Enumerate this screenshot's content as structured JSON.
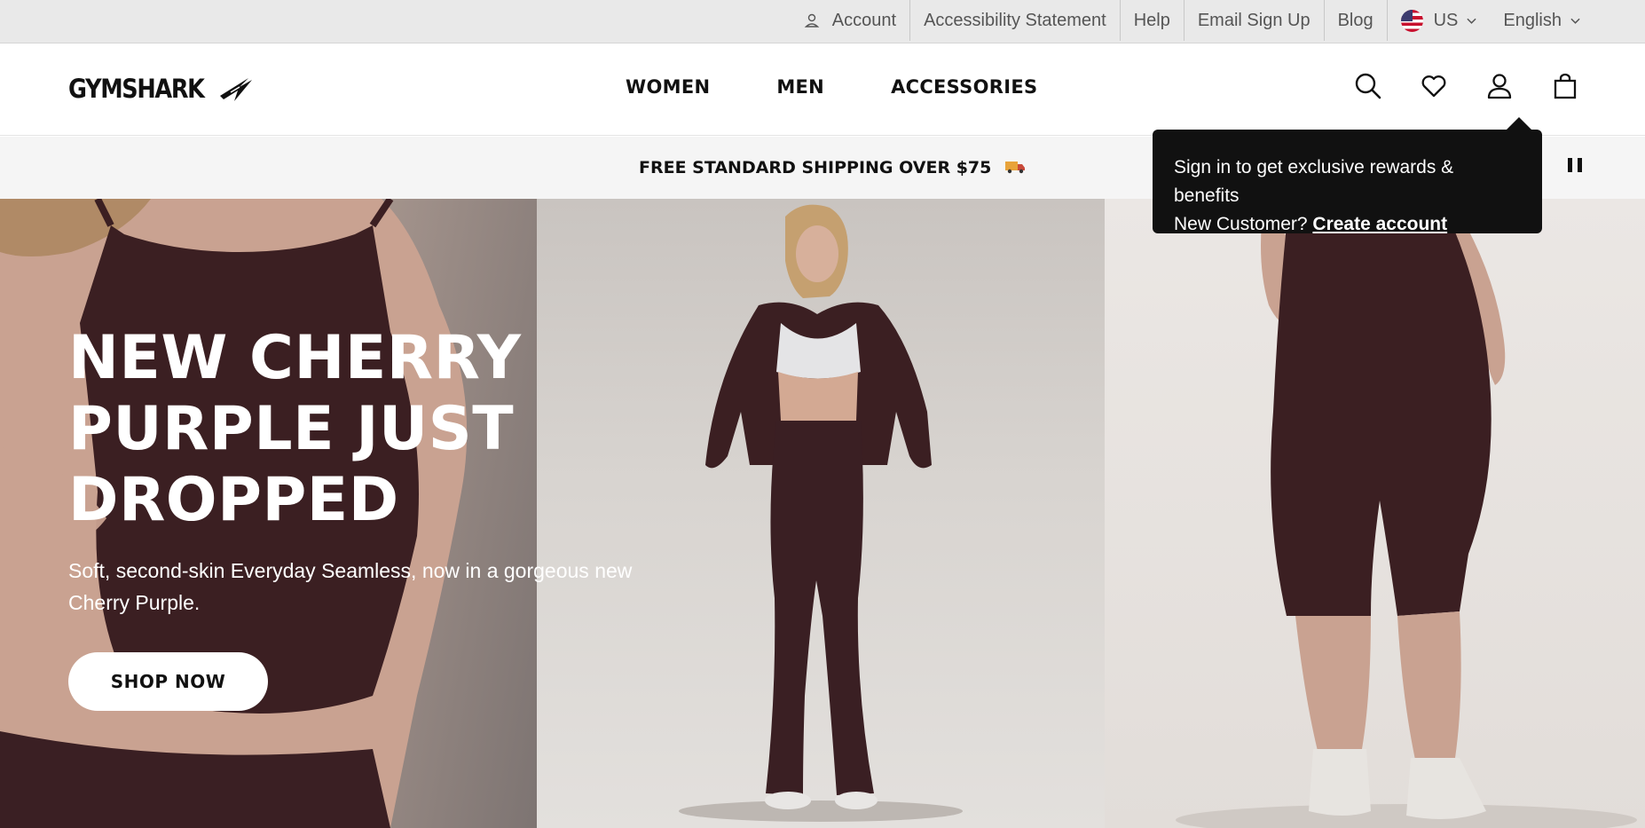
{
  "utility": {
    "account": "Account",
    "accessibility": "Accessibility Statement",
    "help": "Help",
    "email_signup": "Email Sign Up",
    "blog": "Blog",
    "country": "US",
    "language": "English"
  },
  "header": {
    "logo": "GYMSHARK",
    "nav": [
      "WOMEN",
      "MEN",
      "ACCESSORIES"
    ],
    "icons": [
      "search-icon",
      "heart-icon",
      "user-icon",
      "bag-icon"
    ]
  },
  "promo": {
    "text": "FREE STANDARD SHIPPING OVER $75"
  },
  "hero": {
    "title_line1": "NEW CHERRY",
    "title_line2": "PURPLE JUST",
    "title_line3": "DROPPED",
    "subtitle": "Soft, second-skin Everyday Seamless, now in a gorgeous new Cherry Purple.",
    "cta": "SHOP NOW"
  },
  "signin_popup": {
    "line1": "Sign in to get exclusive rewards & benefits",
    "prefix": "New Customer?",
    "link": "Create account"
  },
  "colors": {
    "product": "#3b1f22",
    "popup_bg": "#111111",
    "utility_bg": "#e9e9e9"
  }
}
